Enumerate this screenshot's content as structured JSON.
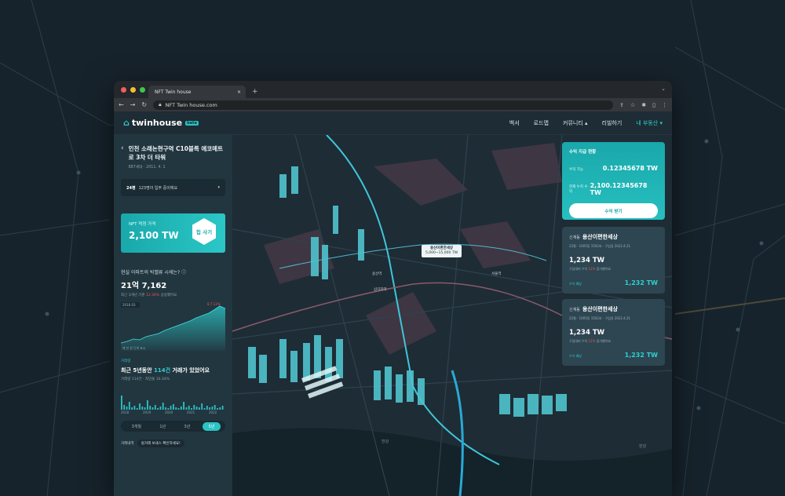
{
  "browser": {
    "tab_title": "NFT Twin house",
    "new_tab": "+",
    "url": "NFT Twin house.com"
  },
  "site": {
    "logo_text": "twinhouse",
    "logo_badge": "beta",
    "nav": [
      "백서",
      "로드맵",
      "커뮤니티 ▴",
      "리빌하기",
      "내 부동산 ▾"
    ]
  },
  "left": {
    "title": "인천 소래논현구역 C10블록 에코메트로 3차 더 타워",
    "subtitle": "887세대 · 2011. 4. 1",
    "select_value": "24평",
    "select_note": "123명이 입주 중이에요",
    "nft_label": "NFT 적정 가격",
    "nft_value": "2,100 TW",
    "buy_label": "집 사기",
    "market_question": "현실 아파트의 빅밸류 시세는?",
    "market_value": "21억 7,162",
    "market_change_prefix": "최근 3개년 기준",
    "market_change": "12.36%",
    "market_change_suffix": "상승했어요",
    "chart_tag_high": "8.7 13%",
    "chart_tag_low": "2016.03",
    "chart_note": "매 만 원 단위 표시",
    "trade_tag": "거래량",
    "trade_title_pre": "최근 5년동안",
    "trade_count": "114건",
    "trade_title_post": "거래가 있었어요",
    "trade_sub": "거래량 114건 · 최민울 10.34%",
    "bar_years": [
      "2018",
      "2019",
      "2020",
      "2021",
      "2022"
    ],
    "segments": [
      "3개월",
      "1년",
      "3년",
      "5년"
    ],
    "active_segment": "5년",
    "foot_label": "거래내역",
    "foot_pill": "실거래 보내스 확인하세요!"
  },
  "map": {
    "popup_title": "용산이편한세상",
    "popup_range": "5,000~15,000 TW",
    "labels": [
      "한강",
      "한강",
      "용산역",
      "삼각지역",
      "서울역"
    ]
  },
  "profit_card": {
    "title": "수익 지급 현황",
    "row1_label": "수익 가능",
    "row1_value": "0.12345678 TW",
    "row2_label": "현재 누적 수익",
    "row2_value": "2,100.12345678 TW",
    "button": "수익 받기"
  },
  "properties": [
    {
      "district": "신계동",
      "name": "용산이편한세상",
      "meta": "22평 · 1005동 1502호 · 구입일 2022.4.21",
      "value": "1,234 TW",
      "note_pre": "구입대비 수익",
      "note_pct": "12%",
      "note_post": "증가했어요",
      "foot_label": "수익 예상",
      "foot_value": "1,232 TW"
    },
    {
      "district": "신계동",
      "name": "용산이편한세상",
      "meta": "22평 · 1005동 1502호 · 구입일 2022.4.21",
      "value": "1,234 TW",
      "note_pre": "구입대비 수익",
      "note_pct": "12%",
      "note_post": "증가했어요",
      "foot_label": "수익 예상",
      "foot_value": "1,232 TW"
    }
  ],
  "colors": {
    "accent": "#2bc3c3",
    "negative": "#ef5350",
    "panel": "#223640",
    "card": "#2d4652"
  }
}
